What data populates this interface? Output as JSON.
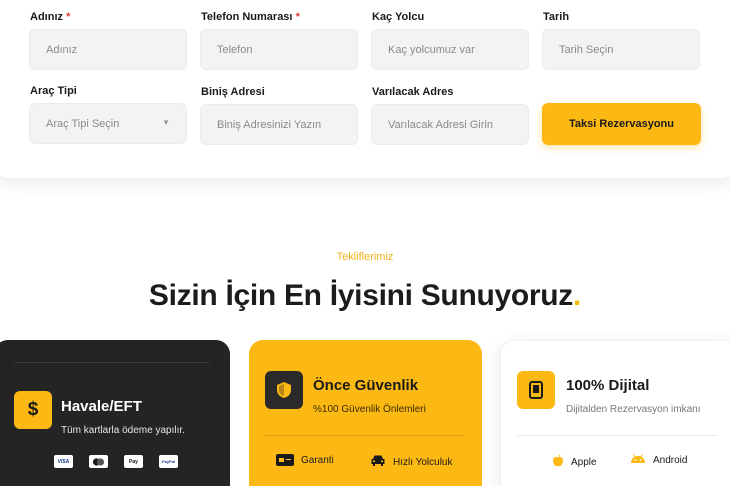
{
  "form": {
    "fields": [
      {
        "label": "Adınız",
        "required": true,
        "placeholder": "Adınız"
      },
      {
        "label": "Telefon Numarası",
        "required": true,
        "placeholder": "Telefon"
      },
      {
        "label": "Kaç Yolcu",
        "required": false,
        "placeholder": "Kaç yolcumuz var"
      },
      {
        "label": "Tarih",
        "required": false,
        "placeholder": "Tarih Seçin"
      },
      {
        "label": "Araç Tipi",
        "required": false,
        "placeholder": "Araç Tipi Seçin"
      },
      {
        "label": "Biniş Adresi",
        "required": false,
        "placeholder": "Biniş Adresinizi Yazın"
      },
      {
        "label": "Varılacak Adres",
        "required": false,
        "placeholder": "Varılacak Adresi Girin"
      }
    ],
    "required_mark": "*",
    "submit_label": "Taksi Rezervasyonu"
  },
  "offers": {
    "eyebrow": "Tekliflerimiz",
    "headline": "Sizin İçin En İyisini Sunuyoruz",
    "headline_dot": "."
  },
  "cards": [
    {
      "title": "Havale/EFT",
      "subtitle": "Tüm kartlarla ödeme yapılır.",
      "icon": "dollar-icon",
      "payments": [
        "VISA",
        "MC",
        "Pay",
        "PayPal"
      ]
    },
    {
      "title": "Önce Güvenlik",
      "subtitle": "%100 Güvenlik Önlemleri",
      "icon": "shield-icon",
      "features": [
        {
          "label": "Garanti",
          "icon": "card-icon"
        },
        {
          "label": "Hızlı Yolculuk",
          "icon": "car-icon"
        }
      ]
    },
    {
      "title": "100% Dijital",
      "subtitle": "Dijitalden Rezervasyon imkanı",
      "icon": "tablet-icon",
      "features": [
        {
          "label": "Apple",
          "icon": "apple-icon"
        },
        {
          "label": "Android",
          "icon": "android-icon"
        }
      ]
    }
  ],
  "colors": {
    "accent": "#fdb913",
    "dark_card": "#242424",
    "required": "#e53935"
  }
}
